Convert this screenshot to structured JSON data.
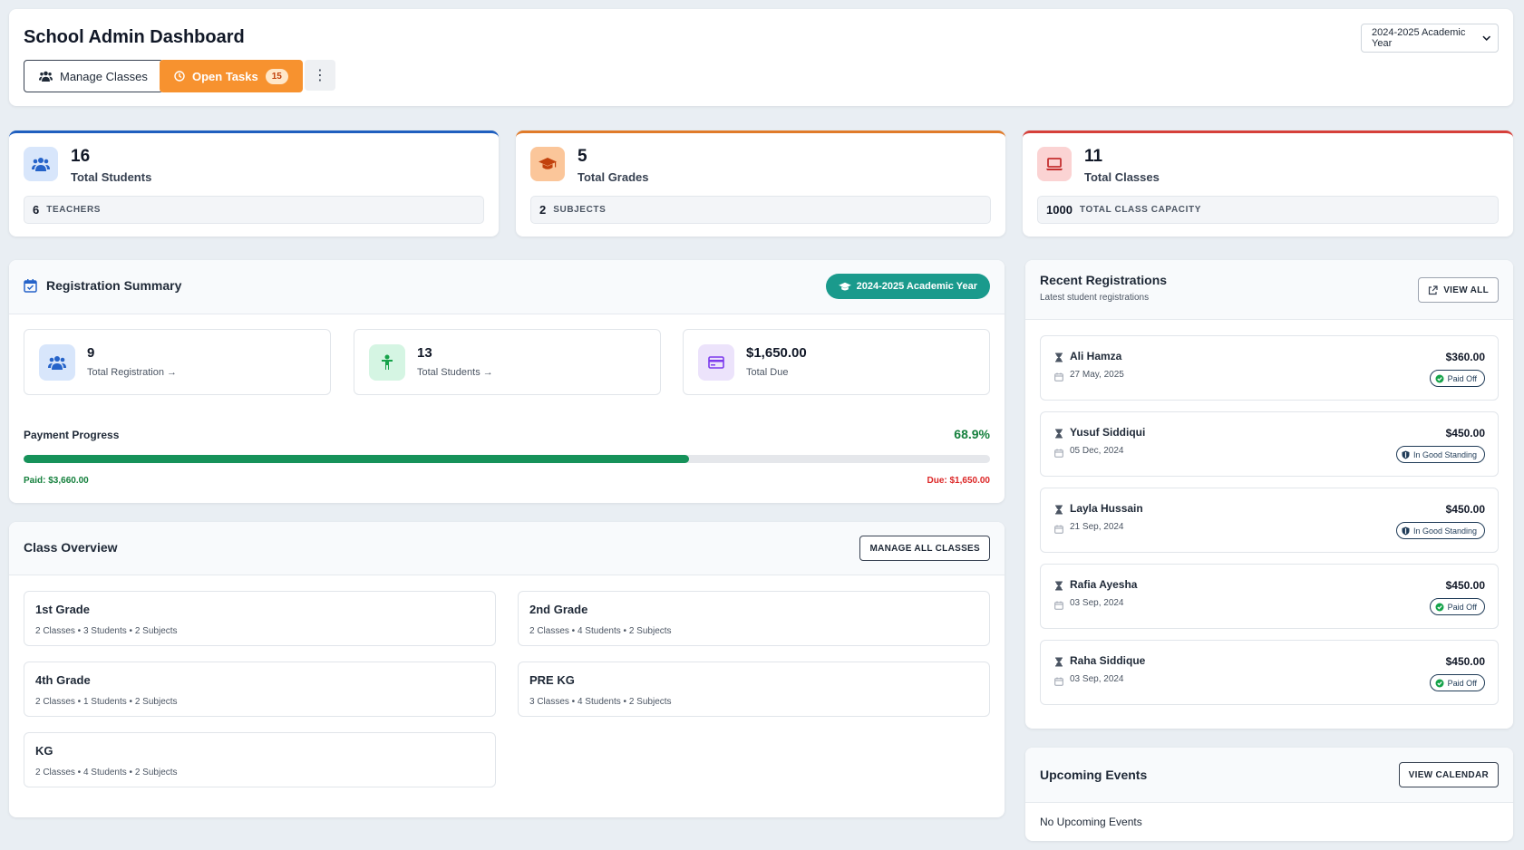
{
  "header": {
    "title": "School Admin Dashboard",
    "manage_classes_label": "Manage Classes",
    "open_tasks_label": "Open Tasks",
    "open_tasks_count": "15",
    "academic_year_select": "2024-2025 Academic Year"
  },
  "stats": [
    {
      "value": "16",
      "label": "Total Students",
      "sub_value": "6",
      "sub_label": "TEACHERS",
      "accent": "#1f5fbf"
    },
    {
      "value": "5",
      "label": "Total Grades",
      "sub_value": "2",
      "sub_label": "SUBJECTS",
      "accent": "#e07b2a"
    },
    {
      "value": "11",
      "label": "Total Classes",
      "sub_value": "1000",
      "sub_label": "TOTAL CLASS CAPACITY",
      "accent": "#d6403a"
    }
  ],
  "registration_summary": {
    "title": "Registration Summary",
    "year_badge": "2024-2025 Academic Year",
    "items": [
      {
        "value": "9",
        "label": "Total Registration"
      },
      {
        "value": "13",
        "label": "Total Students"
      },
      {
        "value": "$1,650.00",
        "label": "Total Due"
      }
    ],
    "payment_progress": {
      "label": "Payment Progress",
      "percent_text": "68.9%",
      "fraction": 0.689,
      "paid_text": "Paid: $3,660.00",
      "due_text": "Due: $1,650.00"
    }
  },
  "class_overview": {
    "title": "Class Overview",
    "manage_all_label": "MANAGE ALL CLASSES",
    "grades": [
      {
        "name": "1st Grade",
        "meta": "2 Classes • 3 Students • 2 Subjects"
      },
      {
        "name": "2nd Grade",
        "meta": "2 Classes • 4 Students • 2 Subjects"
      },
      {
        "name": "4th Grade",
        "meta": "2 Classes • 1 Students • 2 Subjects"
      },
      {
        "name": "PRE KG",
        "meta": "3 Classes • 4 Students • 2 Subjects"
      },
      {
        "name": "KG",
        "meta": "2 Classes • 4 Students • 2 Subjects"
      }
    ]
  },
  "recent_registrations": {
    "title": "Recent Registrations",
    "subtitle": "Latest student registrations",
    "view_all_label": "VIEW ALL",
    "items": [
      {
        "name": "Ali Hamza",
        "date": "27 May, 2025",
        "amount": "$360.00",
        "status": "Paid Off"
      },
      {
        "name": "Yusuf Siddiqui",
        "date": "05 Dec, 2024",
        "amount": "$450.00",
        "status": "In Good Standing"
      },
      {
        "name": "Layla Hussain",
        "date": "21 Sep, 2024",
        "amount": "$450.00",
        "status": "In Good Standing"
      },
      {
        "name": "Rafia Ayesha",
        "date": "03 Sep, 2024",
        "amount": "$450.00",
        "status": "Paid Off"
      },
      {
        "name": "Raha Siddique",
        "date": "03 Sep, 2024",
        "amount": "$450.00",
        "status": "Paid Off"
      }
    ]
  },
  "upcoming_events": {
    "title": "Upcoming Events",
    "view_calendar_label": "VIEW CALENDAR",
    "empty_text": "No Upcoming Events"
  }
}
